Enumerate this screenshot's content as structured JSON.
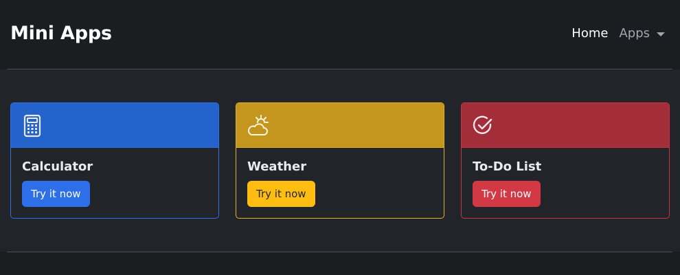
{
  "navbar": {
    "brand": "Mini Apps",
    "home_label": "Home",
    "apps_label": "Apps"
  },
  "cards": [
    {
      "title": "Calculator",
      "button_label": "Try it now",
      "icon": "calculator-icon",
      "accent": "#2d6fe8"
    },
    {
      "title": "Weather",
      "button_label": "Try it now",
      "icon": "cloud-sun-icon",
      "accent": "#ffbd12"
    },
    {
      "title": "To-Do List",
      "button_label": "Try it now",
      "icon": "check-circle-icon",
      "accent": "#d33845"
    }
  ]
}
